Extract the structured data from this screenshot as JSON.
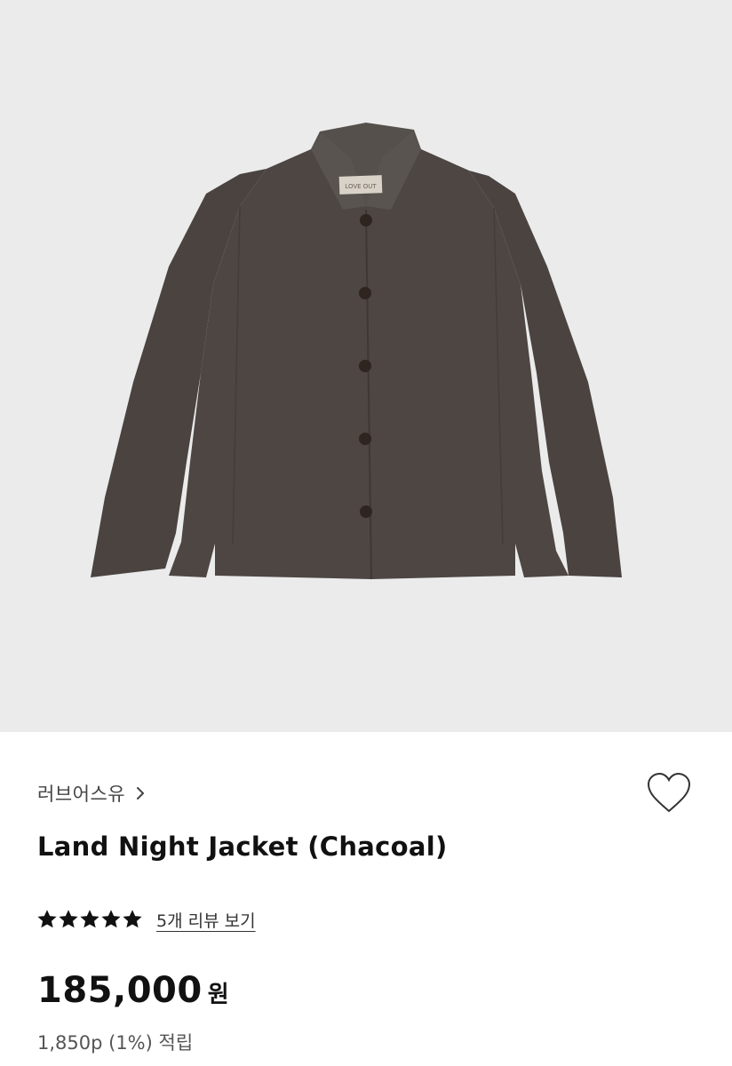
{
  "product_image": {
    "subject": "jacket-photo",
    "background_color": "#ebebec",
    "garment_color": "#4d4642",
    "label_text": "LOVE OUT"
  },
  "brand": {
    "name": "러브어스유",
    "chevron_icon": "chevron-right-icon"
  },
  "wishlist": {
    "icon": "heart-outline-icon"
  },
  "product": {
    "title": "Land Night Jacket (Chacoal)"
  },
  "rating": {
    "stars": 5,
    "max_stars": 5,
    "review_link": "5개 리뷰 보기"
  },
  "price": {
    "amount": "185,000",
    "currency": "원"
  },
  "points": {
    "text": "1,850p (1%) 적립"
  }
}
